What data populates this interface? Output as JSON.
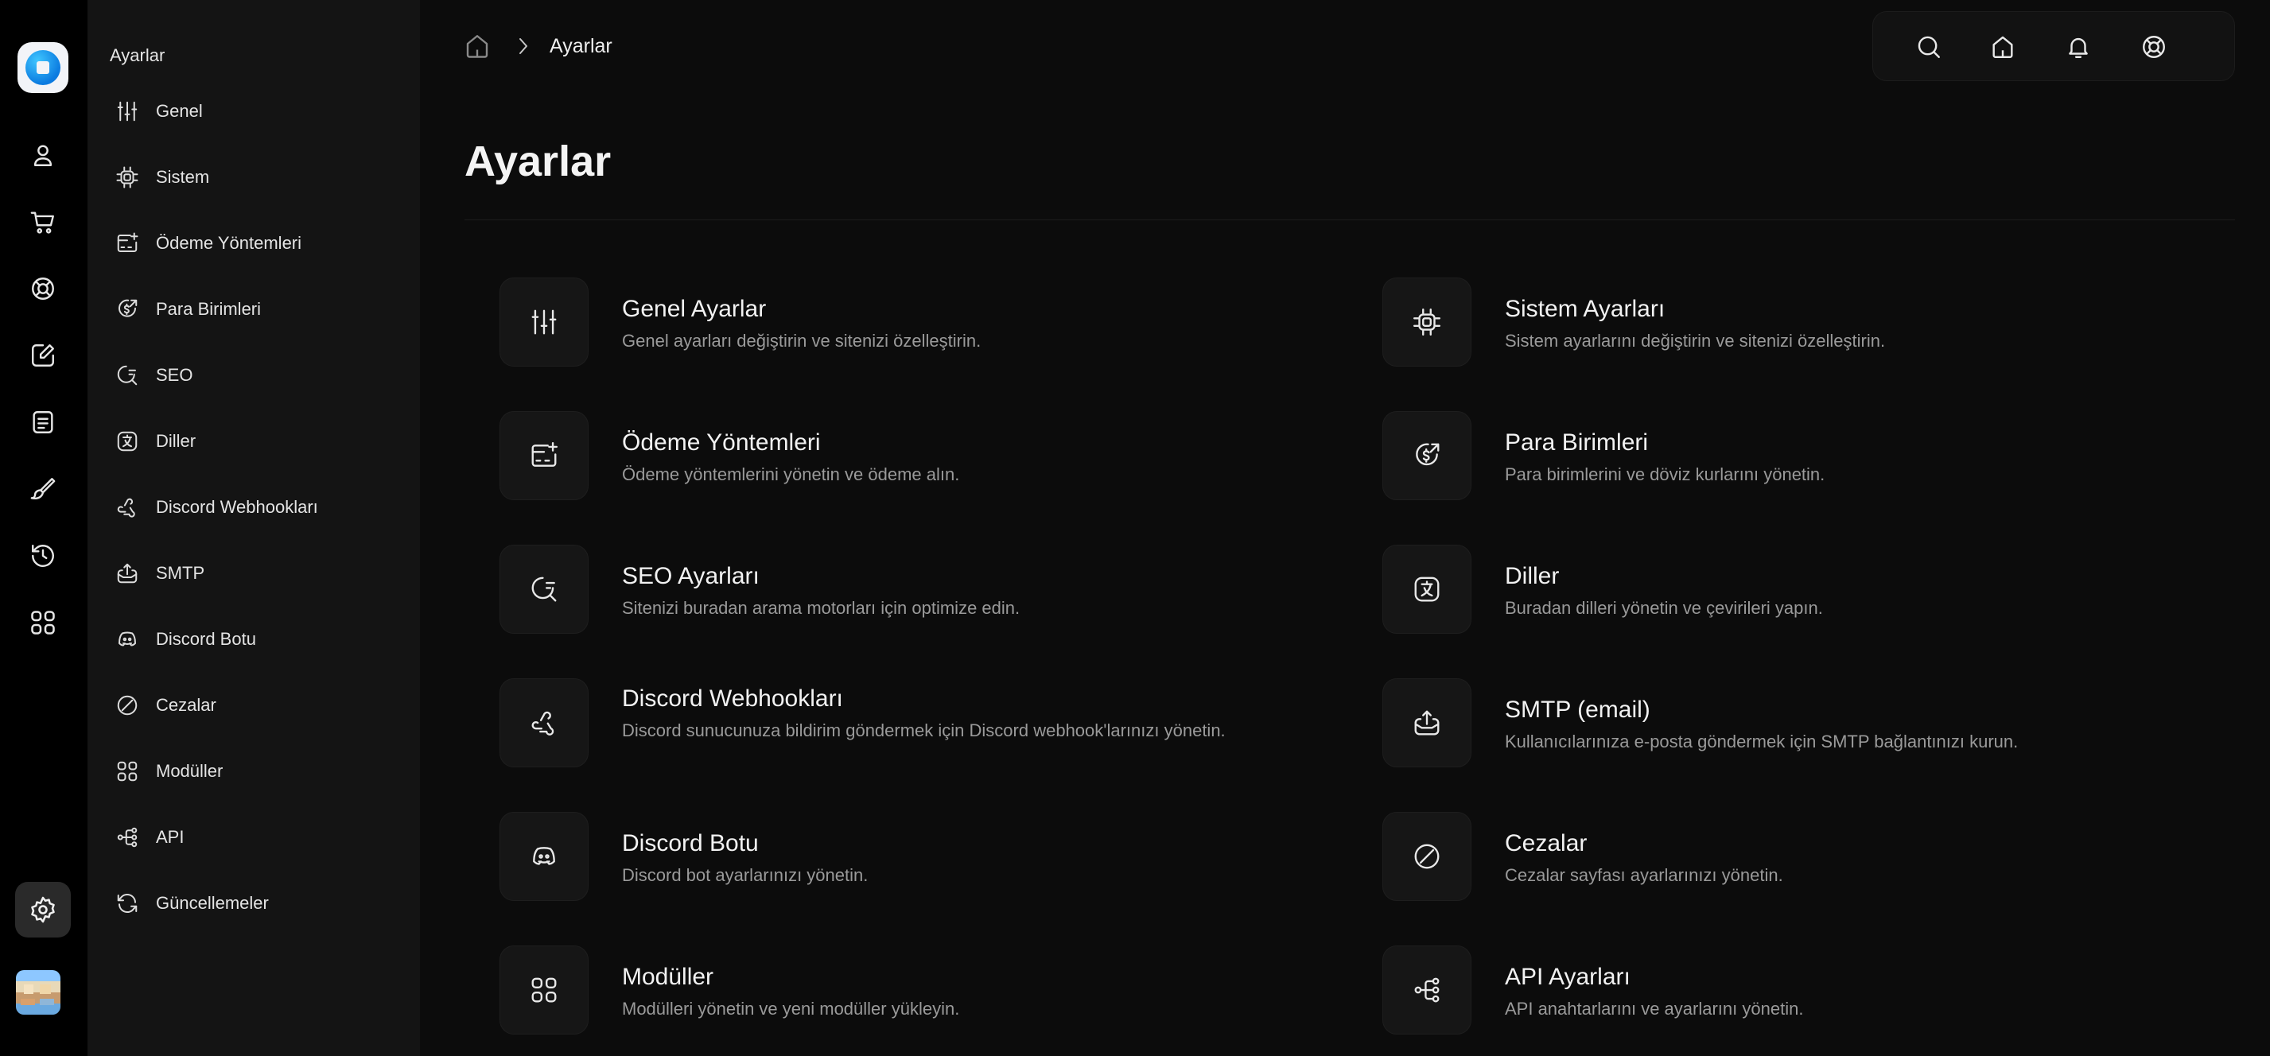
{
  "rail": {
    "icons": [
      "user-icon",
      "cart-icon",
      "lifebuoy-icon",
      "edit-icon",
      "document-icon",
      "brush-icon",
      "history-icon",
      "apps-icon",
      "settings-icon"
    ]
  },
  "sidebar": {
    "title": "Ayarlar",
    "items": [
      {
        "label": "Genel",
        "icon": "sliders-icon"
      },
      {
        "label": "Sistem",
        "icon": "cpu-icon"
      },
      {
        "label": "Ödeme Yöntemleri",
        "icon": "payment-card-icon"
      },
      {
        "label": "Para Birimleri",
        "icon": "currency-icon"
      },
      {
        "label": "SEO",
        "icon": "seo-icon"
      },
      {
        "label": "Diller",
        "icon": "language-icon"
      },
      {
        "label": "Discord Webhookları",
        "icon": "webhook-icon"
      },
      {
        "label": "SMTP",
        "icon": "mail-upload-icon"
      },
      {
        "label": "Discord Botu",
        "icon": "discord-icon"
      },
      {
        "label": "Cezalar",
        "icon": "ban-icon"
      },
      {
        "label": "Modüller",
        "icon": "modules-icon"
      },
      {
        "label": "API",
        "icon": "api-icon"
      },
      {
        "label": "Güncellemeler",
        "icon": "refresh-icon"
      }
    ]
  },
  "breadcrumb": {
    "current": "Ayarlar"
  },
  "topbar": {
    "icons": [
      "search-icon",
      "home-icon",
      "bell-icon",
      "lifebuoy-icon"
    ]
  },
  "page": {
    "title": "Ayarlar"
  },
  "cards": [
    {
      "title": "Genel Ayarlar",
      "desc": "Genel ayarları değiştirin ve sitenizi özelleştirin.",
      "icon": "sliders-icon"
    },
    {
      "title": "Sistem Ayarları",
      "desc": "Sistem ayarlarını değiştirin ve sitenizi özelleştirin.",
      "icon": "cpu-icon"
    },
    {
      "title": "Ödeme Yöntemleri",
      "desc": "Ödeme yöntemlerini yönetin ve ödeme alın.",
      "icon": "payment-card-icon"
    },
    {
      "title": "Para Birimleri",
      "desc": "Para birimlerini ve döviz kurlarını yönetin.",
      "icon": "currency-icon"
    },
    {
      "title": "SEO Ayarları",
      "desc": "Sitenizi buradan arama motorları için optimize edin.",
      "icon": "seo-icon"
    },
    {
      "title": "Diller",
      "desc": "Buradan dilleri yönetin ve çevirileri yapın.",
      "icon": "language-icon"
    },
    {
      "title": "Discord Webhookları",
      "desc": "Discord sunucunuza bildirim göndermek için Discord webhook'larınızı yönetin.",
      "icon": "webhook-icon"
    },
    {
      "title": "SMTP (email)",
      "desc": "Kullanıcılarınıza e-posta göndermek için SMTP bağlantınızı kurun.",
      "icon": "mail-upload-icon"
    },
    {
      "title": "Discord Botu",
      "desc": "Discord bot ayarlarınızı yönetin.",
      "icon": "discord-icon"
    },
    {
      "title": "Cezalar",
      "desc": "Cezalar sayfası ayarlarınızı yönetin.",
      "icon": "ban-icon"
    },
    {
      "title": "Modüller",
      "desc": "Modülleri yönetin ve yeni modüller yükleyin.",
      "icon": "modules-icon"
    },
    {
      "title": "API Ayarları",
      "desc": "API anahtarlarını ve ayarlarını yönetin.",
      "icon": "api-icon"
    }
  ]
}
